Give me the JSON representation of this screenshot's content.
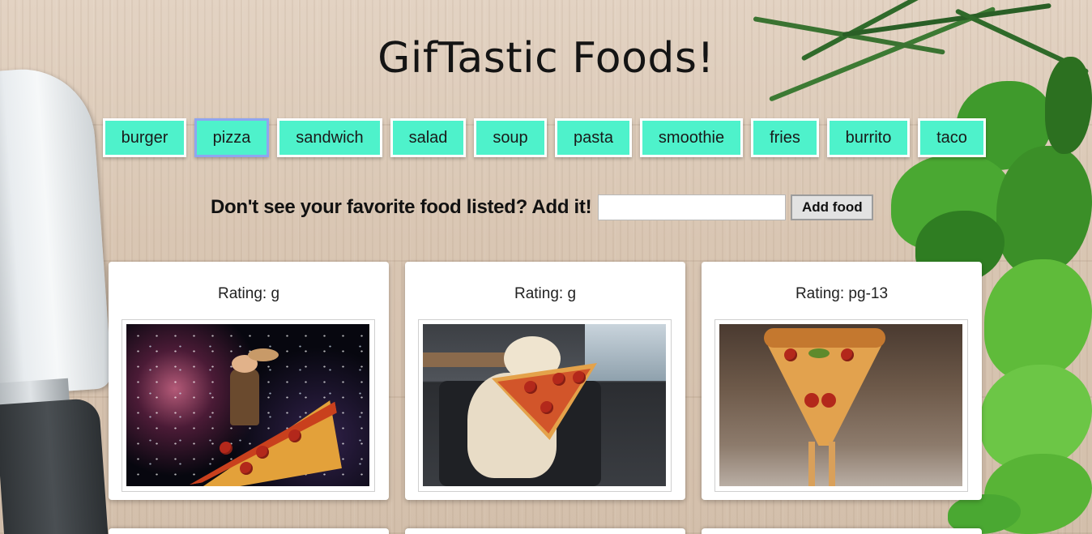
{
  "header": {
    "title": "GifTastic Foods!"
  },
  "food_buttons": [
    {
      "label": "burger",
      "active": false
    },
    {
      "label": "pizza",
      "active": true
    },
    {
      "label": "sandwich",
      "active": false
    },
    {
      "label": "salad",
      "active": false
    },
    {
      "label": "soup",
      "active": false
    },
    {
      "label": "pasta",
      "active": false
    },
    {
      "label": "smoothie",
      "active": false
    },
    {
      "label": "fries",
      "active": false
    },
    {
      "label": "burrito",
      "active": false
    },
    {
      "label": "taco",
      "active": false
    }
  ],
  "add_form": {
    "prompt": "Don't see your favorite food listed? Add it!",
    "input_value": "",
    "button_label": "Add food"
  },
  "gifs": [
    {
      "rating": "Rating: g",
      "depiction": "cowboy riding pizza slice in space"
    },
    {
      "rating": "Rating: g",
      "depiction": "dog holding pizza slice in mouth"
    },
    {
      "rating": "Rating: pg-13",
      "depiction": "dancing pizza slice character"
    }
  ],
  "colors": {
    "button_bg": "#4ef2cb",
    "button_border": "#ffffff",
    "active_button_border": "#8ea6f0",
    "card_bg": "#ffffff"
  }
}
